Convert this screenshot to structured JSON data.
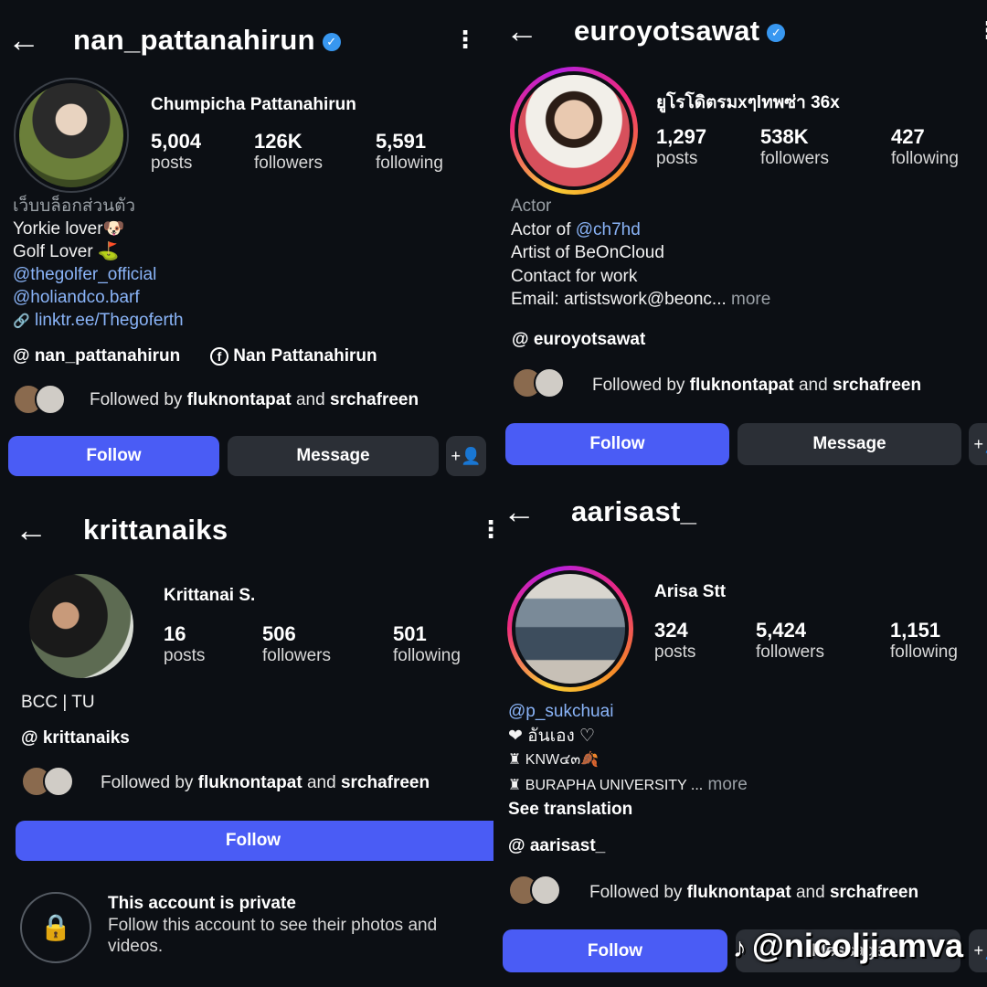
{
  "icons": {
    "back": "←",
    "more": "⋮",
    "verified": "✓",
    "threads": "@",
    "facebook": "f",
    "link": "🔗",
    "lock": "🔒",
    "add_person": "+👤",
    "tiktok": "♪"
  },
  "colors": {
    "follow_button": "#4a5cf5",
    "link_text": "#8ab4f8",
    "verified_badge": "#3897f0",
    "background": "#0c0f14"
  },
  "profiles": [
    {
      "username": "nan_pattanahirun",
      "verified": true,
      "full_name": "Chumpicha Pattanahirun",
      "stats": {
        "posts": "5,004",
        "followers": "126K",
        "following": "5,591"
      },
      "stat_labels": {
        "posts": "posts",
        "followers": "followers",
        "following": "following"
      },
      "category": "เว็บบล็อกส่วนตัว",
      "bio": [
        "Yorkie lover🐶",
        "Golf Lover ⛳"
      ],
      "mentions": [
        "@thegolfer_official",
        "@holiandco.barf"
      ],
      "link": "linktr.ee/Thegoferth",
      "threads_handle": "nan_pattanahirun",
      "facebook_name": "Nan Pattanahirun",
      "followed_by": {
        "prefix": "Followed by",
        "user1": "fluknontapat",
        "joiner": "and",
        "user2": "srchafreen"
      },
      "buttons": {
        "follow": "Follow",
        "message": "Message"
      }
    },
    {
      "username": "euroyotsawat",
      "verified": true,
      "full_name": "ยูโรโดิตรมxๆlทพซ่า 36x",
      "stats": {
        "posts": "1,297",
        "followers": "538K",
        "following": "427"
      },
      "stat_labels": {
        "posts": "posts",
        "followers": "followers",
        "following": "following"
      },
      "category": "Actor",
      "bio_line1_prefix": "Actor of ",
      "bio_line1_mention": "@ch7hd",
      "bio": [
        "Artist of BeOnCloud",
        "Contact for work"
      ],
      "email_line": "Email: artistswork@beonc...",
      "more": "more",
      "threads_handle": "euroyotsawat",
      "followed_by": {
        "prefix": "Followed by",
        "user1": "fluknontapat",
        "joiner": "and",
        "user2": "srchafreen"
      },
      "buttons": {
        "follow": "Follow",
        "message": "Message"
      }
    },
    {
      "username": "krittanaiks",
      "verified": false,
      "full_name": "Krittanai S.",
      "stats": {
        "posts": "16",
        "followers": "506",
        "following": "501"
      },
      "stat_labels": {
        "posts": "posts",
        "followers": "followers",
        "following": "following"
      },
      "bio": [
        "BCC | TU"
      ],
      "threads_handle": "krittanaiks",
      "followed_by": {
        "prefix": "Followed by",
        "user1": "fluknontapat",
        "joiner": "and",
        "user2": "srchafreen"
      },
      "buttons": {
        "follow": "Follow"
      },
      "private": {
        "title": "This account is private",
        "line1": "Follow this account to see their photos and",
        "line2": "videos."
      }
    },
    {
      "username": "aarisast_",
      "verified": false,
      "full_name": "Arisa Stt",
      "stats": {
        "posts": "324",
        "followers": "5,424",
        "following": "1,151"
      },
      "stat_labels": {
        "posts": "posts",
        "followers": "followers",
        "following": "following"
      },
      "mention": "@p_sukchuai",
      "bio": [
        "❤ อันเอง ♡",
        "♜ KNW๔๓🍂",
        "♜ BURAPHA UNIVERSITY ..."
      ],
      "more": "more",
      "see_translation": "See translation",
      "threads_handle": "aarisast_",
      "followed_by": {
        "prefix": "Followed by",
        "user1": "fluknontapat",
        "joiner": "and",
        "user2": "srchafreen"
      },
      "buttons": {
        "follow": "Follow",
        "message": "Message"
      }
    }
  ],
  "watermark": "@nicoljiamva"
}
